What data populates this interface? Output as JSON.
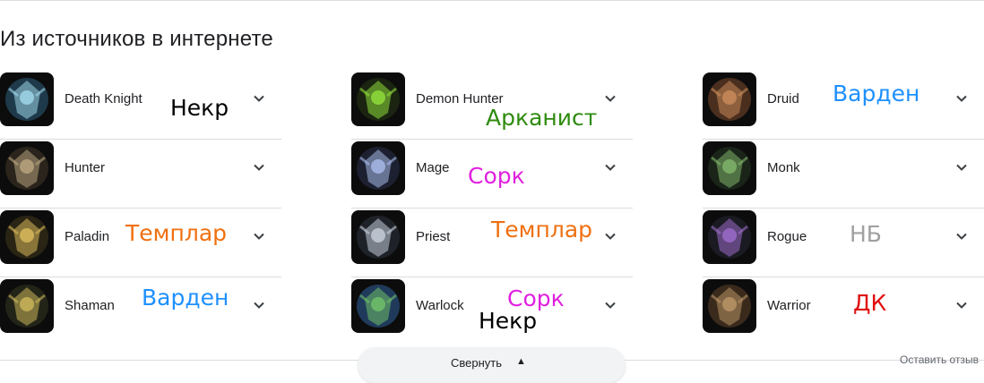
{
  "section": {
    "title": "Из источников в интернете"
  },
  "columns": [
    [
      {
        "label": "Death Knight",
        "icon": "death-knight-icon",
        "bg": "#1e3a4a",
        "fg": "#9fd6e8"
      },
      {
        "label": "Hunter",
        "icon": "hunter-icon",
        "bg": "#2a241c",
        "fg": "#b7a37d"
      },
      {
        "label": "Paladin",
        "icon": "paladin-icon",
        "bg": "#2a2414",
        "fg": "#d7b85a"
      },
      {
        "label": "Shaman",
        "icon": "shaman-icon",
        "bg": "#232418",
        "fg": "#c9b45a"
      }
    ],
    [
      {
        "label": "Demon Hunter",
        "icon": "demon-hunter-icon",
        "bg": "#1a2410",
        "fg": "#8fdc3a"
      },
      {
        "label": "Mage",
        "icon": "mage-icon",
        "bg": "#1c2030",
        "fg": "#a7b9e8"
      },
      {
        "label": "Priest",
        "icon": "priest-icon",
        "bg": "#1e2228",
        "fg": "#c3ccd8"
      },
      {
        "label": "Warlock",
        "icon": "warlock-icon",
        "bg": "#1f3a5a",
        "fg": "#6fbf6a"
      }
    ],
    [
      {
        "label": "Druid",
        "icon": "druid-icon",
        "bg": "#4a2e1e",
        "fg": "#c88a5a"
      },
      {
        "label": "Monk",
        "icon": "monk-icon",
        "bg": "#1a2418",
        "fg": "#7fb36a"
      },
      {
        "label": "Rogue",
        "icon": "rogue-icon",
        "bg": "#1a1a22",
        "fg": "#9a6bc8"
      },
      {
        "label": "Warrior",
        "icon": "warrior-icon",
        "bg": "#3a2a1c",
        "fg": "#b89366"
      }
    ]
  ],
  "annotations": [
    {
      "text": "Некр",
      "color": "#000000"
    },
    {
      "text": "Арканист",
      "color": "#2e8b0f"
    },
    {
      "text": "Варден",
      "color": "#1e90ff"
    },
    {
      "text": "Сорк",
      "color": "#e020e0"
    },
    {
      "text": "Темплар",
      "color": "#f07010"
    },
    {
      "text": "Темплар",
      "color": "#f07010"
    },
    {
      "text": "НБ",
      "color": "#a0a0a0"
    },
    {
      "text": "Варден",
      "color": "#1e90ff"
    },
    {
      "text": "Сорк",
      "color": "#e020e0"
    },
    {
      "text": "Некр",
      "color": "#000000"
    },
    {
      "text": "ДК",
      "color": "#e01010"
    }
  ],
  "footer": {
    "collapse_label": "Свернуть",
    "feedback_label": "Оставить отзыв"
  }
}
